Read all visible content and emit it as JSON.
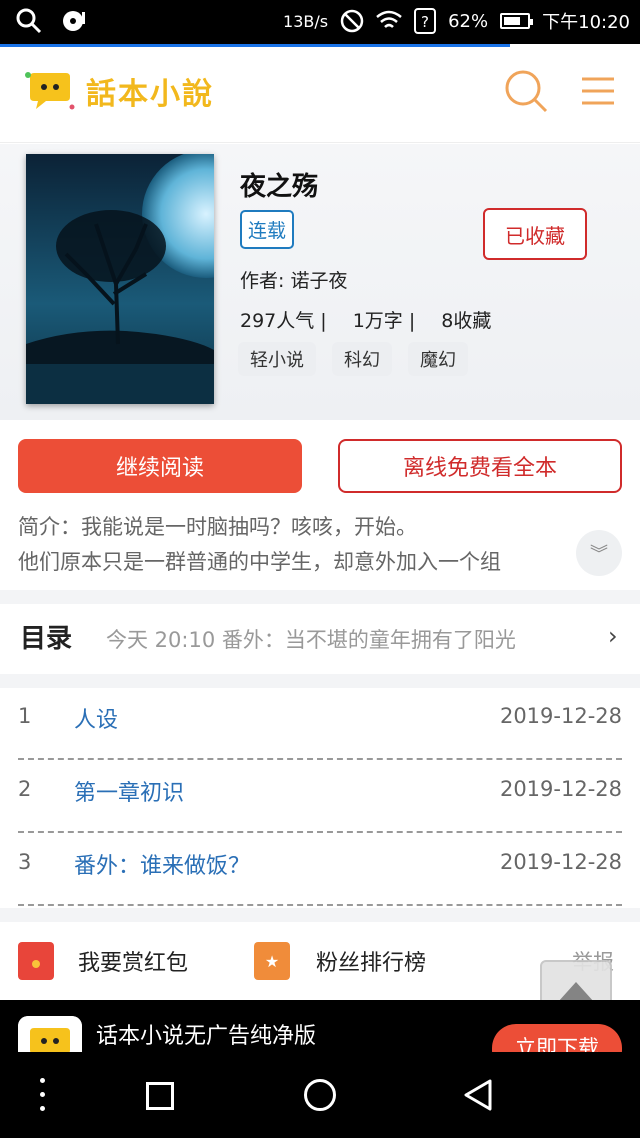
{
  "status_bar": {
    "net_speed": "13B/s",
    "battery": "62%",
    "time": "下午10:20"
  },
  "header": {
    "app_name": "話本小說"
  },
  "book": {
    "title": "夜之殇",
    "status": "连载",
    "collect_label": "已收藏",
    "author": "作者: 诺子夜",
    "popularity": "297人气 |",
    "words": "1万字 |",
    "favorites": "8收藏",
    "tags": [
      "轻小说",
      "科幻",
      "魔幻"
    ]
  },
  "actions": {
    "continue_read": "继续阅读",
    "offline_read": "离线免费看全本"
  },
  "intro": {
    "line1": "简介：我能说是一时脑抽吗？咳咳，开始。",
    "line2": "他们原本只是一群普通的中学生，却意外加入一个组"
  },
  "catalog": {
    "title": "目录",
    "latest": "今天 20:10    番外：当不堪的童年拥有了阳光",
    "chapters": [
      {
        "num": "1",
        "name": "人设",
        "date": "2019-12-28"
      },
      {
        "num": "2",
        "name": "第一章初识",
        "date": "2019-12-28"
      },
      {
        "num": "3",
        "name": "番外：谁来做饭？",
        "date": "2019-12-28"
      }
    ]
  },
  "bottom": {
    "reward": "我要赏红包",
    "fans": "粉丝排行榜",
    "report": "举报"
  },
  "ad": {
    "text": "话本小说无广告纯净版",
    "button": "立即下载"
  },
  "colors": {
    "accent_red": "#ec4e37",
    "link_blue": "#2a6fb6",
    "logo_yellow": "#f2b81d",
    "search_orange": "#f0a45a"
  }
}
